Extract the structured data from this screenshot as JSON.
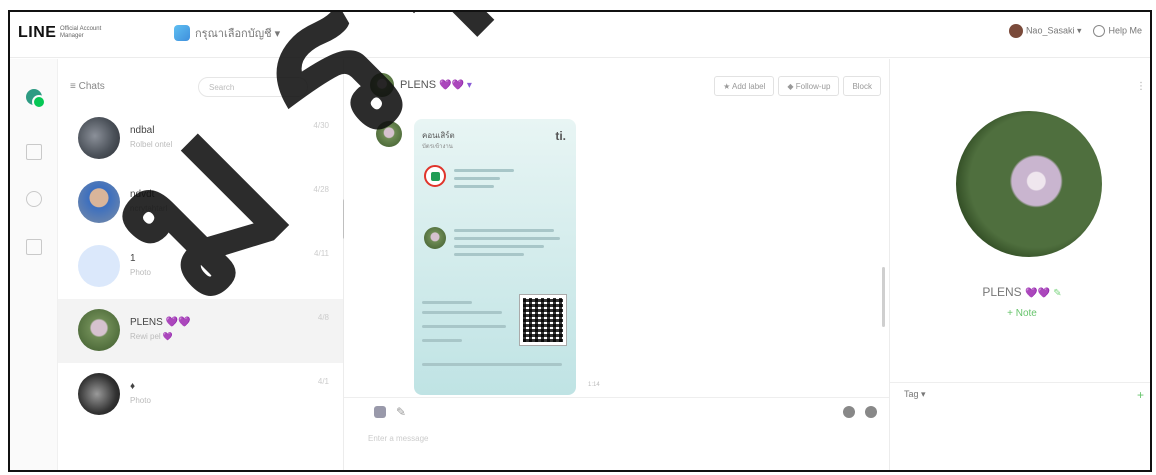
{
  "header": {
    "logo": "LINE",
    "logo_sub": "Official Account Manager",
    "account_name": "กรุณาเลือกบัญชี ▾",
    "user_name": "Nao_Sasaki ▾",
    "help_label": "Help Me"
  },
  "chatlist": {
    "filter_label": "≡ Chats",
    "search_placeholder": "Search",
    "items": [
      {
        "name": "ndbal",
        "preview": "Rolbel ontel",
        "time": "4/30"
      },
      {
        "name": "ndvdt",
        "preview": "ncrytahtarl",
        "time": "4/28"
      },
      {
        "name": "1",
        "preview": "Photo",
        "time": "4/11"
      },
      {
        "name": "PLENS 💜💜",
        "preview": "Rewi pel 💜",
        "time": "4/8"
      },
      {
        "name": "♦",
        "preview": "Photo",
        "time": "4/1"
      }
    ]
  },
  "chat": {
    "title": "PLENS",
    "title_hearts": "💜💜 ▾",
    "buttons": [
      "★ Add label",
      "◆ Follow-up",
      "Block"
    ],
    "card": {
      "title": "คอนเสิร์ต",
      "subtitle": "บัตรเข้างาน",
      "logo": "ti.",
      "time": "1:14"
    },
    "compose_placeholder": "Enter a message"
  },
  "profile": {
    "more": "⋮",
    "name": "PLENS",
    "hearts": "💜💜",
    "edit": "✎",
    "status": "+ Note",
    "tag_label": "Tag ▾",
    "tag_add": "+"
  },
  "watermark": {
    "text": "ม ร ก",
    "text_top": "ฟ"
  },
  "colors": {
    "line_green": "#06c755",
    "accent_green": "#67c46c",
    "card_bg": "#bfe3e4",
    "mark_red": "#e0342b"
  }
}
